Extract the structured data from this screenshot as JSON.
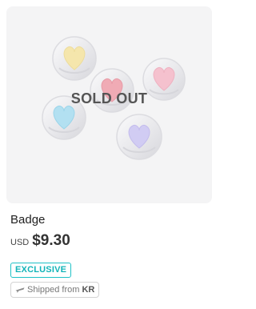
{
  "product": {
    "title": "Badge",
    "status_overlay": "SOLD OUT",
    "currency": "USD",
    "price": "$9.30",
    "tags": {
      "exclusive": "EXCLUSIVE",
      "shipped_from_label": "Shipped from",
      "shipped_from_country": "KR"
    },
    "icons": {
      "shipping": "plane-icon"
    },
    "colors": {
      "exclusive_accent": "#12b4b8",
      "image_background": "#f4f4f5"
    }
  }
}
